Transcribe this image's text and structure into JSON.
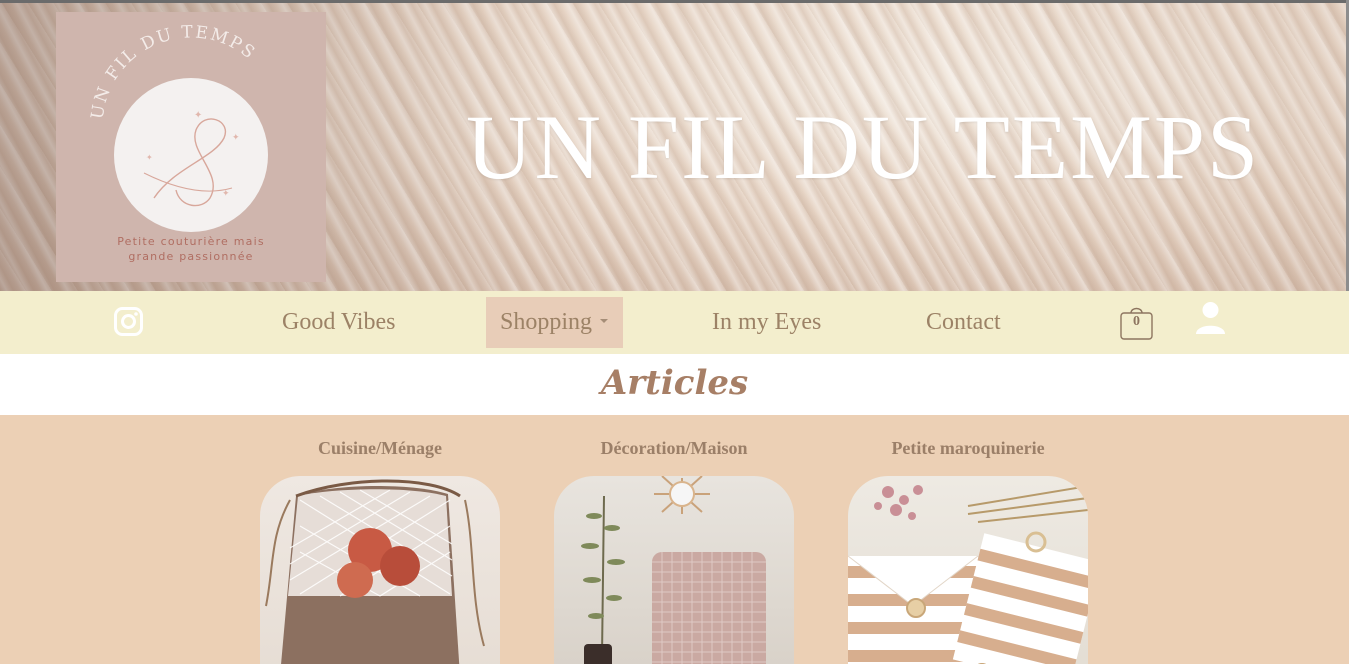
{
  "hero": {
    "title": "UN FIL DU TEMPS",
    "logo": {
      "arc_text": "UN FIL DU TEMPS",
      "tagline_line1": "Petite couturière mais",
      "tagline_line2": "grande passionnée"
    }
  },
  "nav": {
    "instagram_icon": "instagram-icon",
    "items": [
      {
        "label": "Good Vibes"
      },
      {
        "label": "Shopping",
        "active": true,
        "has_dropdown": true
      },
      {
        "label": "In my Eyes"
      },
      {
        "label": "Contact"
      }
    ],
    "cart_count": "0",
    "user_icon": "user-icon"
  },
  "articles": {
    "title": "Articles",
    "categories": [
      {
        "label": "Cuisine/Ménage"
      },
      {
        "label": "Décoration/Maison"
      },
      {
        "label": "Petite maroquinerie"
      }
    ]
  },
  "colors": {
    "nav_bg": "#f3eecd",
    "nav_active_bg": "#e8cdb8",
    "nav_text": "#9c8266",
    "content_bg": "#ecd0b5",
    "accent": "#a77f66"
  }
}
